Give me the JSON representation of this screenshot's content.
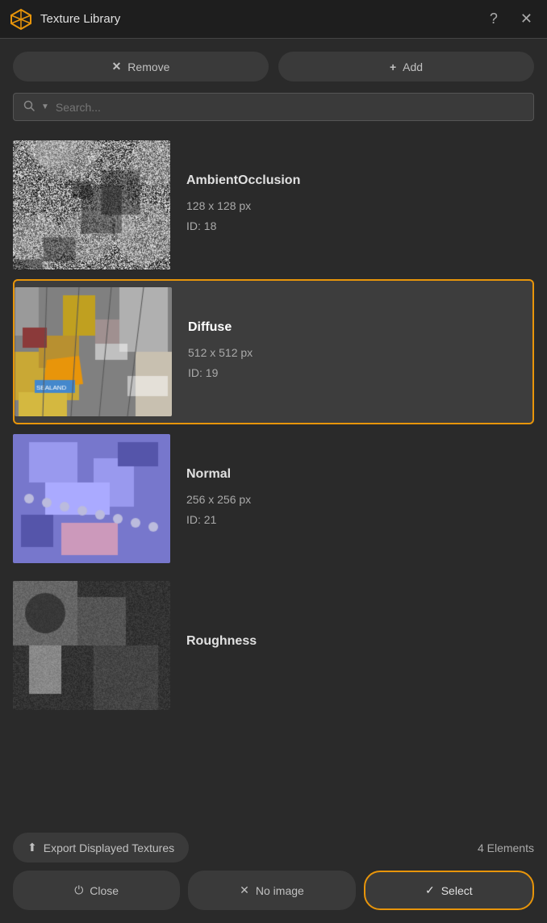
{
  "window": {
    "title": "Texture Library",
    "help_label": "?",
    "close_label": "✕"
  },
  "toolbar": {
    "remove_label": "Remove",
    "remove_icon": "✕",
    "add_label": "Add",
    "add_icon": "+"
  },
  "search": {
    "placeholder": "Search..."
  },
  "textures": [
    {
      "id": 0,
      "name": "AmbientOcclusion",
      "size": "128 x 128 px",
      "id_label": "ID: 18",
      "type": "ao",
      "selected": false
    },
    {
      "id": 1,
      "name": "Diffuse",
      "size": "512 x 512 px",
      "id_label": "ID: 19",
      "type": "diffuse",
      "selected": true
    },
    {
      "id": 2,
      "name": "Normal",
      "size": "256 x 256 px",
      "id_label": "ID: 21",
      "type": "normal",
      "selected": false
    },
    {
      "id": 3,
      "name": "Roughness",
      "size": "",
      "id_label": "",
      "type": "roughness",
      "selected": false
    }
  ],
  "bottom": {
    "export_icon": "⬆",
    "export_label": "Export Displayed Textures",
    "elements_label": "4 Elements"
  },
  "footer": {
    "close_icon": "⏻",
    "close_label": "Close",
    "no_image_icon": "✕",
    "no_image_label": "No image",
    "select_icon": "✓",
    "select_label": "Select"
  },
  "colors": {
    "accent": "#e8950a",
    "selected_bg": "#3d3d3d"
  }
}
